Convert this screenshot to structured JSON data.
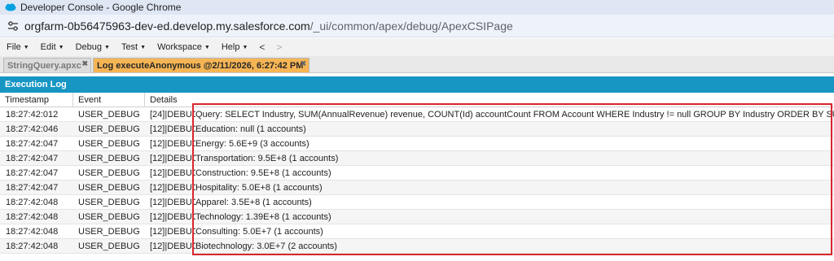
{
  "window": {
    "title": "Developer Console - Google Chrome",
    "url_host": "orgfarm-0b56475963-dev-ed.develop.my.salesforce.com",
    "url_path": "/_ui/common/apex/debug/ApexCSIPage"
  },
  "menu": {
    "items": [
      {
        "label": "File"
      },
      {
        "label": "Edit"
      },
      {
        "label": "Debug"
      },
      {
        "label": "Test"
      },
      {
        "label": "Workspace"
      },
      {
        "label": "Help"
      }
    ],
    "back": "<",
    "forward": ">"
  },
  "tabs": [
    {
      "label": "StringQuery.apxc",
      "active": false
    },
    {
      "label": "Log executeAnonymous @2/11/2026, 6:27:42 PM",
      "active": true
    }
  ],
  "execution_log": {
    "title": "Execution Log",
    "columns": {
      "timestamp": "Timestamp",
      "event": "Event",
      "details": "Details"
    },
    "rows": [
      {
        "timestamp": "18:27:42:012",
        "event": "USER_DEBUG",
        "prefix": "[24]|DEBUG|",
        "message": "Query: SELECT Industry, SUM(AnnualRevenue) revenue, COUNT(Id) accountCount FROM Account WHERE Industry != null GROUP BY Industry ORDER BY SUM(AnnualRevenue) DESC"
      },
      {
        "timestamp": "18:27:42:046",
        "event": "USER_DEBUG",
        "prefix": "[12]|DEBUG|",
        "message": "Education: null (1 accounts)"
      },
      {
        "timestamp": "18:27:42:047",
        "event": "USER_DEBUG",
        "prefix": "[12]|DEBUG|",
        "message": "Energy: 5.6E+9 (3 accounts)"
      },
      {
        "timestamp": "18:27:42:047",
        "event": "USER_DEBUG",
        "prefix": "[12]|DEBUG|",
        "message": "Transportation: 9.5E+8 (1 accounts)"
      },
      {
        "timestamp": "18:27:42:047",
        "event": "USER_DEBUG",
        "prefix": "[12]|DEBUG|",
        "message": "Construction: 9.5E+8 (1 accounts)"
      },
      {
        "timestamp": "18:27:42:047",
        "event": "USER_DEBUG",
        "prefix": "[12]|DEBUG|",
        "message": "Hospitality: 5.0E+8 (1 accounts)"
      },
      {
        "timestamp": "18:27:42:048",
        "event": "USER_DEBUG",
        "prefix": "[12]|DEBUG|",
        "message": "Apparel: 3.5E+8 (1 accounts)"
      },
      {
        "timestamp": "18:27:42:048",
        "event": "USER_DEBUG",
        "prefix": "[12]|DEBUG|",
        "message": "Technology: 1.39E+8 (1 accounts)"
      },
      {
        "timestamp": "18:27:42:048",
        "event": "USER_DEBUG",
        "prefix": "[12]|DEBUG|",
        "message": "Consulting: 5.0E+7 (1 accounts)"
      },
      {
        "timestamp": "18:27:42:048",
        "event": "USER_DEBUG",
        "prefix": "[12]|DEBUG|",
        "message": "Biotechnology: 3.0E+7 (2 accounts)"
      }
    ]
  },
  "colors": {
    "log_header": "#1796c4",
    "active_tab": "#f6b555",
    "highlight_box": "#d9262c"
  }
}
